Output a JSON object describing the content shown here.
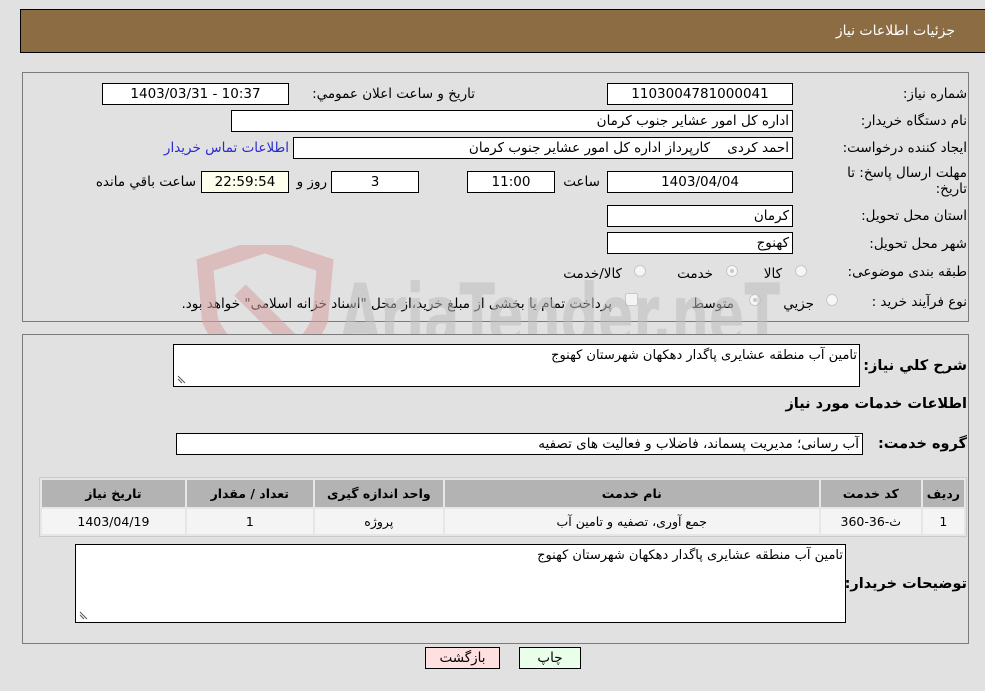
{
  "header": {
    "title": "جزئیات اطلاعات نیاز"
  },
  "details": {
    "need_number": {
      "label": "شماره نیاز:",
      "value": "1103004781000041"
    },
    "announce_datetime": {
      "label": "تاریخ و ساعت اعلان عمومي:",
      "value": "1403/03/31 - 10:37"
    },
    "buyer_org": {
      "label": "نام دستگاه خریدار:",
      "value": "اداره کل امور عشایر جنوب کرمان"
    },
    "requester": {
      "label": "ایجاد کننده درخواست:",
      "value": "احمد کردی    کارپرداز اداره کل امور عشایر جنوب کرمان"
    },
    "buyer_contact_link": "اطلاعات تماس خریدار",
    "deadline": {
      "label_line1": "مهلت ارسال پاسخ: تا",
      "label_line2": "تاریخ:",
      "date": "1403/04/04",
      "time_label": "ساعت",
      "time": "11:00",
      "days": "3",
      "days_label": "روز و",
      "remaining": "22:59:54",
      "remaining_label": "ساعت باقي مانده"
    },
    "province": {
      "label": "استان محل تحویل:",
      "value": "کرمان"
    },
    "city": {
      "label": "شهر محل تحویل:",
      "value": "کهنوج"
    },
    "category": {
      "label": "طبقه بندی موضوعی:",
      "options": [
        {
          "label": "کالا",
          "selected": false
        },
        {
          "label": "خدمت",
          "selected": true
        },
        {
          "label": "کالا/خدمت",
          "selected": false
        }
      ]
    },
    "purchase_type": {
      "label": "نوع فرآیند خرید :",
      "options": [
        {
          "label": "جزيي",
          "selected": false
        },
        {
          "label": "متوسط",
          "selected": true
        }
      ],
      "treasury_checkbox_label": "پرداخت تمام یا بخشی از مبلغ خرید،از محل \"اسناد خزانه اسلامی\" خواهد بود.",
      "treasury_checked": false
    }
  },
  "need": {
    "summary_label": "شرح کلي نیاز:",
    "summary": "تامین آب منطقه عشایری پاگدار دهکهان شهرستان کهنوج",
    "services_heading": "اطلاعات خدمات مورد نیاز",
    "service_group_label": "گروه خدمت:",
    "service_group": "آب رسانی؛ مدیریت پسماند، فاضلاب و فعالیت های تصفیه",
    "table": {
      "headers": [
        "ردیف",
        "کد خدمت",
        "نام خدمت",
        "واحد اندازه گیری",
        "تعداد / مقدار",
        "تاریخ نیاز"
      ],
      "rows": [
        [
          "1",
          "ث-36-360",
          "جمع آوری، تصفیه و تامین آب",
          "پروژه",
          "1",
          "1403/04/19"
        ]
      ]
    },
    "buyer_notes_label": "توضیحات خریدار:",
    "buyer_notes": "تامین آب منطقه عشایری پاگدار دهکهان شهرستان کهنوج"
  },
  "buttons": {
    "print": "چاپ",
    "back": "بازگشت"
  },
  "watermark": {
    "text": "AriaTender.neT"
  },
  "colors": {
    "header_bg": "#8c6c43",
    "print_bg": "#eaffea",
    "back_bg": "#ffe0e0",
    "link": "#2a2acf"
  }
}
